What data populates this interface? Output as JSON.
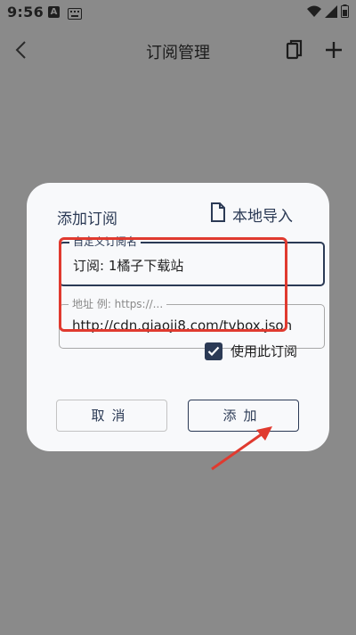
{
  "status_bar": {
    "time": "9:56",
    "notification_a": "A",
    "icons": [
      "keyboard-icon",
      "wifi-icon",
      "signal-icon",
      "battery-icon"
    ]
  },
  "app_bar": {
    "title": "订阅管理",
    "icons": [
      "back-icon",
      "copy-icon",
      "add-icon"
    ]
  },
  "dialog": {
    "title": "添加订阅",
    "local_import_label": "本地导入",
    "name_field": {
      "label": "自定义订阅名",
      "value": "订阅: 1橘子下载站"
    },
    "url_field": {
      "label": "地址 例: https://...",
      "value": "http://cdn.qiaoji8.com/tvbox.json"
    },
    "use_subscription": {
      "label": "使用此订阅",
      "checked": true
    },
    "cancel_label": "取消",
    "add_label": "添加"
  },
  "colors": {
    "accent": "#2b3a55",
    "annotation": "#e03a2f",
    "scrim": "#8a8a8a"
  }
}
